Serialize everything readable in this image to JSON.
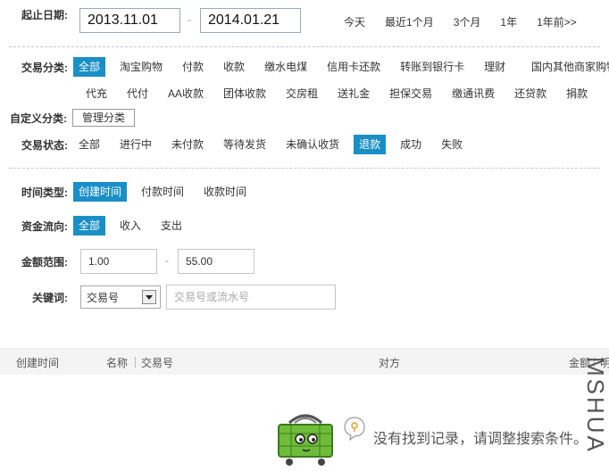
{
  "date_range": {
    "label": "起止日期:",
    "start": "2013.11.01",
    "separator": "-",
    "end": "2014.01.21",
    "quick": [
      "今天",
      "最近1个月",
      "3个月",
      "1年",
      "1年前>>"
    ]
  },
  "category": {
    "label": "交易分类:",
    "row1": [
      "全部",
      "淘宝购物",
      "付款",
      "收款",
      "缴水电煤",
      "信用卡还款",
      "转账到银行卡",
      "理财",
      "国内其他商家购物"
    ],
    "row2": [
      "代充",
      "代付",
      "AA收款",
      "团体收款",
      "交房租",
      "送礼金",
      "担保交易",
      "缴通讯费",
      "还贷款",
      "捐款"
    ],
    "selected": "全部"
  },
  "custom_category": {
    "label": "自定义分类:",
    "manage_button": "管理分类"
  },
  "status": {
    "label": "交易状态:",
    "options": [
      "全部",
      "进行中",
      "未付款",
      "等待发货",
      "未确认收货",
      "退款",
      "成功",
      "失败"
    ],
    "selected": "退款"
  },
  "time_type": {
    "label": "时间类型:",
    "options": [
      "创建时间",
      "付款时间",
      "收款时间"
    ],
    "selected": "创建时间"
  },
  "fund_flow": {
    "label": "资金流向:",
    "options": [
      "全部",
      "收入",
      "支出"
    ],
    "selected": "全部"
  },
  "amount": {
    "label": "金额范围:",
    "min": "1.00",
    "separator": "-",
    "max": "55.00"
  },
  "keyword": {
    "label": "关键词:",
    "select_value": "交易号",
    "placeholder": "交易号或流水号"
  },
  "table": {
    "columns": [
      "创建时间",
      "名称",
      "交易号",
      "对方",
      "金额",
      "明"
    ]
  },
  "empty_state": {
    "message": "没有找到记录，请调整搜索条件。"
  },
  "watermark": "MSHUA",
  "colors": {
    "accent": "#1a8fc6",
    "mascot": "#6ebd3a"
  }
}
